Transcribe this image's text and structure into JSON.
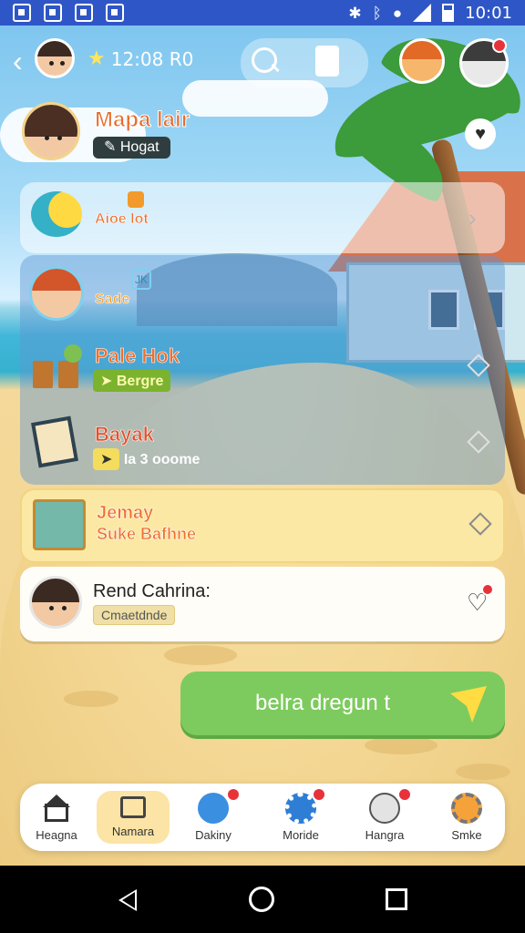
{
  "status_bar": {
    "time": "10:01",
    "icons": [
      "notification-icon",
      "notification-icon",
      "notification-icon",
      "notification-icon",
      "nfc-icon",
      "bluetooth-icon",
      "location-icon",
      "signal-icon",
      "battery-icon"
    ]
  },
  "top_bar": {
    "time": "12:08 R0",
    "icons": [
      "back-icon",
      "star-icon",
      "search-icon",
      "document-icon"
    ]
  },
  "profile": {
    "name": "Mapa lair",
    "tag": "Hogat"
  },
  "items": [
    {
      "title": "Aioe lot"
    },
    {
      "title": "Sade",
      "badge": "JK"
    },
    {
      "title": "Pale Hok",
      "tag": "Bergre"
    },
    {
      "title": "Bayak",
      "tag": "Ia 3 ooome"
    },
    {
      "title": "Jemay",
      "subtitle": "Suke Bafhne"
    },
    {
      "title": "Rend Cahrina:",
      "tag": "Cmaetdnde"
    }
  ],
  "cta": {
    "label": "belra dregun t"
  },
  "nav": [
    {
      "label": "Heagna",
      "icon": "home-icon"
    },
    {
      "label": "Namara",
      "icon": "calendar-icon",
      "active": true
    },
    {
      "label": "Dakiny",
      "icon": "bird-icon"
    },
    {
      "label": "Moride",
      "icon": "gear-icon"
    },
    {
      "label": "Hangra",
      "icon": "palette-icon"
    },
    {
      "label": "Smke",
      "icon": "settings-icon"
    }
  ],
  "colors": {
    "status_bar": "#2f56c6",
    "accent_orange": "#ee6f2d",
    "cta_green": "#7dcb5e",
    "badge_red": "#e8323a",
    "active_nav": "#fbe4a6"
  }
}
